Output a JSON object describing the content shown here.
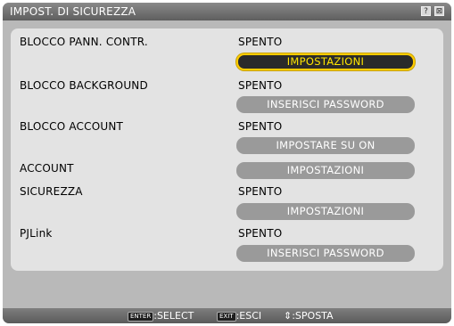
{
  "window": {
    "title": "IMPOST. DI SICUREZZA",
    "help_glyph": "?",
    "close_glyph": "⊠"
  },
  "rows": [
    {
      "label": "BLOCCO PANN. CONTR.",
      "value": "SPENTO",
      "button": "IMPOSTAZIONI",
      "selected": true
    },
    {
      "label": "BLOCCO BACKGROUND",
      "value": "SPENTO",
      "button": "INSERISCI PASSWORD",
      "selected": false
    },
    {
      "label": "BLOCCO ACCOUNT",
      "value": "SPENTO",
      "button": "IMPOSTARE SU ON",
      "selected": false
    },
    {
      "label": "ACCOUNT",
      "value": "",
      "button": "IMPOSTAZIONI",
      "selected": false
    },
    {
      "label": "SICUREZZA",
      "value": "SPENTO",
      "button": "IMPOSTAZIONI",
      "selected": false
    },
    {
      "label": "PJLink",
      "value": "SPENTO",
      "button": "INSERISCI PASSWORD",
      "selected": false
    }
  ],
  "footer": {
    "enter_key": "ENTER",
    "enter_text": ":SELECT",
    "exit_key": "EXIT",
    "exit_text": ":ESCI",
    "move_glyph": "⇕",
    "move_text": ":SPOSTA"
  },
  "colors": {
    "selected_text": "#ffe600",
    "selected_border": "#ffcc00",
    "button_bg": "#9a9a9a"
  }
}
